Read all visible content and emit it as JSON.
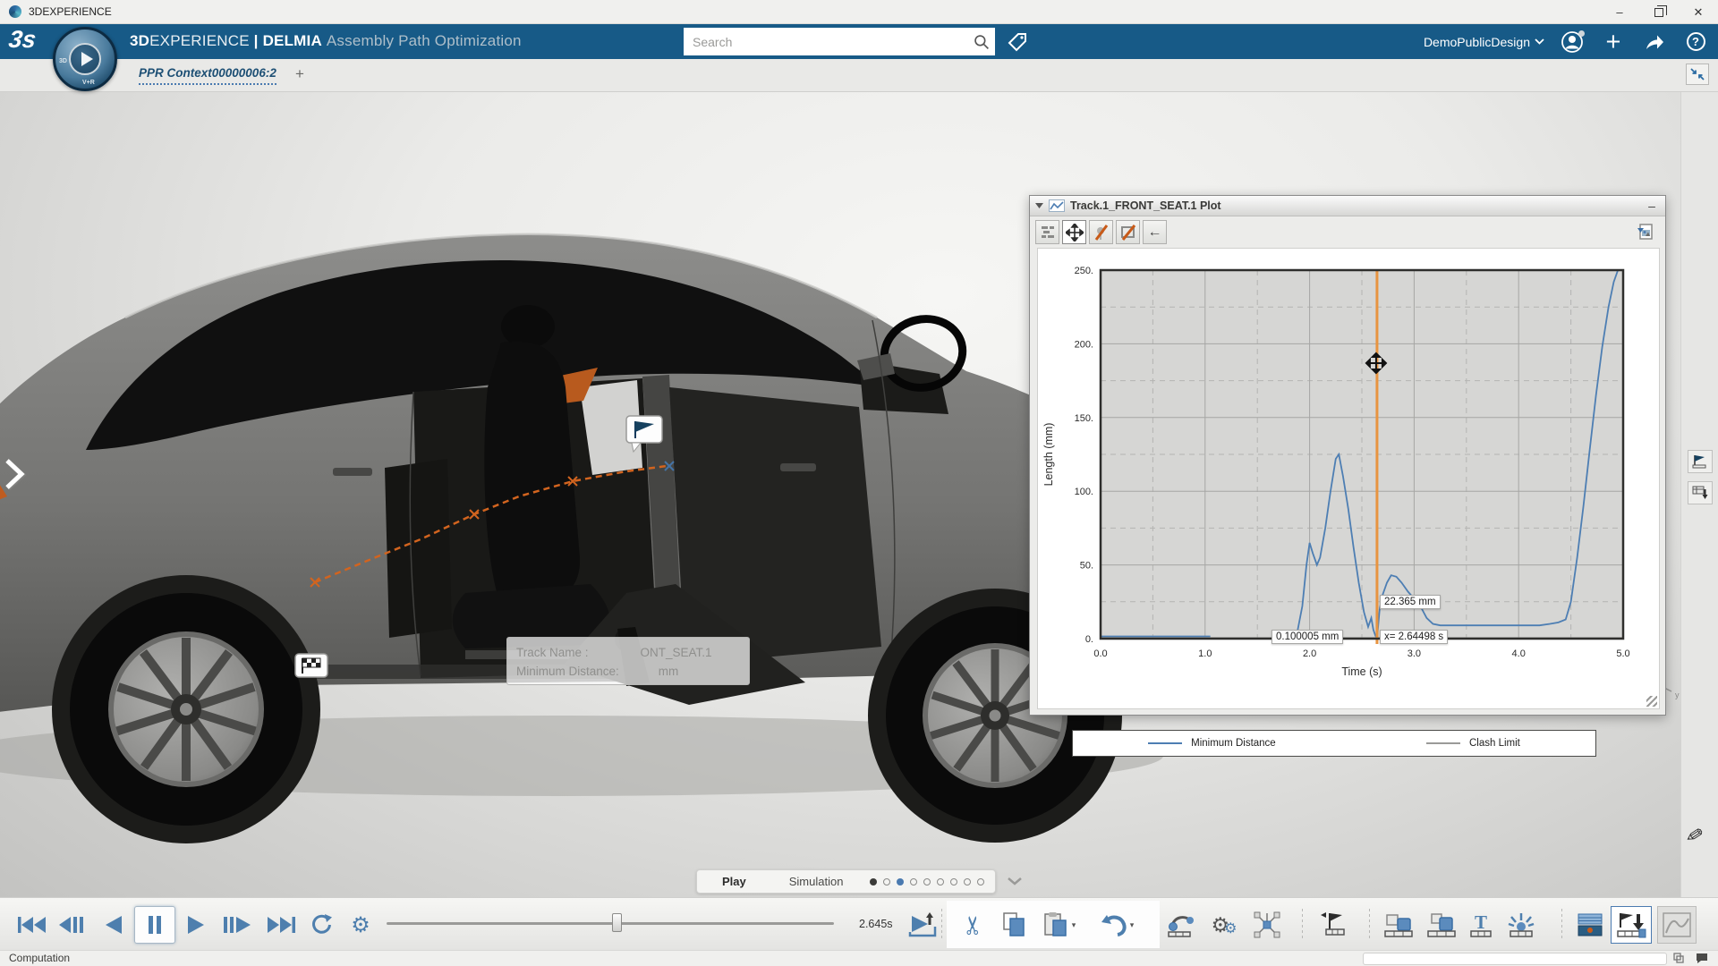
{
  "window": {
    "title": "3DEXPERIENCE",
    "controls": {
      "minimize": "–",
      "restore": "restore",
      "close": "✕"
    }
  },
  "header": {
    "brand": {
      "bold": "3D",
      "rest": "EXPERIENCE",
      "divider": "|",
      "app": "DELMIA",
      "module": "Assembly Path Optimization"
    },
    "search": {
      "placeholder": "Search"
    },
    "user": "DemoPublicDesign",
    "icons": [
      "user-avatar-icon",
      "plus-icon",
      "share-icon",
      "help-icon"
    ]
  },
  "tabbar": {
    "active_tab": "PPR Context00000006:2",
    "add_label": "+"
  },
  "viewport": {
    "track_tooltip": {
      "line1_label": "Track Name :",
      "line1_value": "ONT_SEAT.1",
      "line2_label": "Minimum Distance:",
      "line2_value": "mm"
    },
    "right_rail_icons": [
      "track-flag-icon",
      "table-download-icon"
    ],
    "corner_icons": [
      "axis-triad",
      "pencil-cursor"
    ]
  },
  "plot_window": {
    "title": "Track.1_FRONT_SEAT.1 Plot",
    "minimize_glyph": "–",
    "toolbar_icons": [
      "display-options-icon",
      "pan-icon",
      "marker-disabled-icon",
      "area-select-disabled-icon",
      "back-arrow-icon",
      "export-image-icon"
    ],
    "back_glyph": "←",
    "cursor_labels": {
      "marker_value": "22.365 mm",
      "cursor_value": "0.100005 mm",
      "cursor_x": "x= 2.64498 s"
    }
  },
  "chart_data": {
    "type": "line",
    "title": "Track.1_FRONT_SEAT.1 Plot",
    "xlabel": "Time (s)",
    "ylabel": "Length (mm)",
    "xlim": [
      0,
      5
    ],
    "ylim": [
      0,
      250
    ],
    "x_ticks": [
      0,
      1,
      2,
      3,
      4,
      5
    ],
    "x_tick_labels": [
      "0.0",
      "1.0",
      "2.0",
      "3.0",
      "4.0",
      "5.0"
    ],
    "y_ticks": [
      0,
      50,
      100,
      150,
      200,
      250
    ],
    "y_tick_labels": [
      "0.",
      "50.",
      "100.",
      "150.",
      "200.",
      "250."
    ],
    "grid": "major-solid minor-dashed",
    "legend_position": "bottom",
    "cursor_time_s": 2.64498,
    "cursor_value_mm": 0.100005,
    "marker_value_mm": 22.365,
    "cursor_color": "#e89440",
    "series": [
      {
        "name": "Minimum Distance",
        "color": "#4d7eb3",
        "width": 1.8,
        "segments": [
          [
            [
              0,
              1.5
            ],
            [
              1.05,
              1.5
            ]
          ],
          [
            [
              1.87,
              0
            ],
            [
              1.93,
              22
            ],
            [
              1.97,
              50
            ],
            [
              2.0,
              65
            ],
            [
              2.03,
              58
            ],
            [
              2.07,
              50
            ],
            [
              2.1,
              55
            ],
            [
              2.15,
              75
            ],
            [
              2.2,
              100
            ],
            [
              2.25,
              122
            ],
            [
              2.28,
              125
            ],
            [
              2.32,
              110
            ],
            [
              2.37,
              88
            ],
            [
              2.42,
              62
            ],
            [
              2.47,
              38
            ],
            [
              2.52,
              18
            ],
            [
              2.56,
              8
            ],
            [
              2.59,
              14
            ],
            [
              2.61,
              6
            ],
            [
              2.63,
              2
            ],
            [
              2.645,
              0.1
            ],
            [
              2.67,
              20
            ],
            [
              2.7,
              30
            ],
            [
              2.74,
              38
            ],
            [
              2.78,
              43
            ],
            [
              2.83,
              42
            ],
            [
              2.88,
              38
            ],
            [
              2.94,
              32
            ],
            [
              3.0,
              27
            ],
            [
              3.06,
              22
            ],
            [
              3.12,
              14
            ],
            [
              3.18,
              10
            ],
            [
              3.25,
              9
            ],
            [
              3.4,
              9
            ],
            [
              3.6,
              9
            ],
            [
              3.8,
              9
            ],
            [
              4.0,
              9
            ],
            [
              4.2,
              9
            ],
            [
              4.3,
              10
            ],
            [
              4.38,
              11
            ],
            [
              4.45,
              13
            ],
            [
              4.5,
              25
            ],
            [
              4.56,
              55
            ],
            [
              4.62,
              90
            ],
            [
              4.68,
              128
            ],
            [
              4.74,
              165
            ],
            [
              4.8,
              198
            ],
            [
              4.86,
              225
            ],
            [
              4.91,
              242
            ],
            [
              4.95,
              250
            ]
          ]
        ]
      },
      {
        "name": "Clash Limit",
        "color": "#9a9a98",
        "width": 1.5,
        "segments": [
          [
            [
              0,
              0.5
            ],
            [
              5,
              0.5
            ]
          ]
        ]
      }
    ]
  },
  "playback": {
    "buttons": [
      "jump-to-start",
      "step-backward",
      "play-backward",
      "pause",
      "play-forward",
      "step-forward",
      "jump-to-end",
      "loop",
      "settings"
    ],
    "active_button": "pause",
    "time_label": "2.645s",
    "pill": {
      "play_label": "Play",
      "mode_label": "Simulation",
      "dots": [
        "filled-dark",
        "hollow",
        "filled-blue",
        "hollow",
        "hollow",
        "hollow",
        "hollow",
        "hollow",
        "hollow"
      ]
    }
  },
  "edit_toolbar": [
    "cut-icon",
    "copy-icon",
    "paste-icon",
    "undo-icon"
  ],
  "workbench_toolbar": [
    "robot-icon",
    "process-gears-icon",
    "network-icon",
    "track-flag-icon",
    "swap-products-icon",
    "swap-products-alt-icon",
    "text-annotation-icon",
    "burst-highlight-icon",
    "table-blue-icon",
    "track-export-icon",
    "plot-chart-icon"
  ],
  "statusbar": {
    "text": "Computation"
  }
}
